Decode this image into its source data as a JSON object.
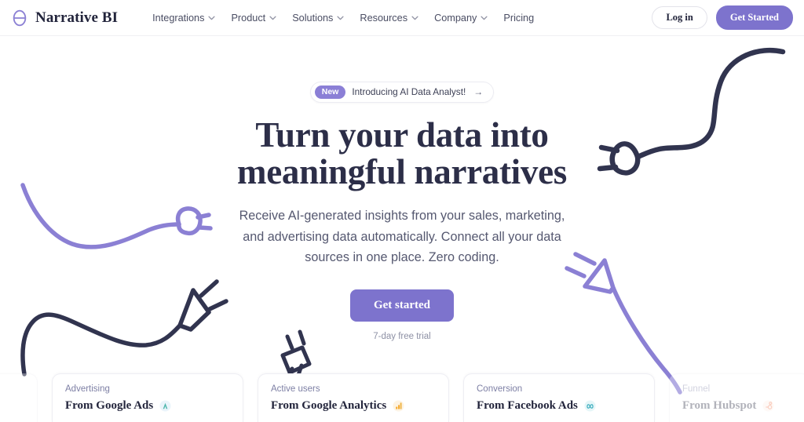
{
  "brand": {
    "name": "Narrative BI",
    "logo_icon": "narrative-bi-theta-logo"
  },
  "header": {
    "nav": [
      {
        "label": "Integrations",
        "has_dropdown": true
      },
      {
        "label": "Product",
        "has_dropdown": true
      },
      {
        "label": "Solutions",
        "has_dropdown": true
      },
      {
        "label": "Resources",
        "has_dropdown": true
      },
      {
        "label": "Company",
        "has_dropdown": true
      },
      {
        "label": "Pricing",
        "has_dropdown": false
      }
    ],
    "login_label": "Log in",
    "get_started_label": "Get Started"
  },
  "hero": {
    "pill": {
      "badge": "New",
      "text": "Introducing AI Data Analyst!",
      "arrow": "→"
    },
    "headline_line1": "Turn your data into",
    "headline_line2": "meaningful narratives",
    "subhead": "Receive AI-generated insights from your sales, marketing, and advertising data automatically. Connect all your data sources in one place. Zero coding.",
    "cta_label": "Get started",
    "trial_note": "7-day free trial"
  },
  "cards": [
    {
      "label": "",
      "title": "",
      "icon": "",
      "variant": "edge-left"
    },
    {
      "label": "Advertising",
      "title": "From Google Ads",
      "icon": "google-ads-icon",
      "variant": "c1"
    },
    {
      "label": "Active users",
      "title": "From Google Analytics",
      "icon": "google-analytics-icon",
      "variant": "c2"
    },
    {
      "label": "Conversion",
      "title": "From Facebook Ads",
      "icon": "facebook-ads-icon",
      "variant": "c3"
    },
    {
      "label": "Funnel",
      "title": "From Hubspot",
      "icon": "hubspot-icon",
      "variant": "edge-right"
    }
  ],
  "colors": {
    "purple": "#7d73cd",
    "purple_light": "#8b7fd6",
    "navy": "#2c2e48",
    "body_text": "#555870",
    "muted": "#8d90a4",
    "card_label": "#7d7fa4",
    "background": "#ffffff"
  }
}
